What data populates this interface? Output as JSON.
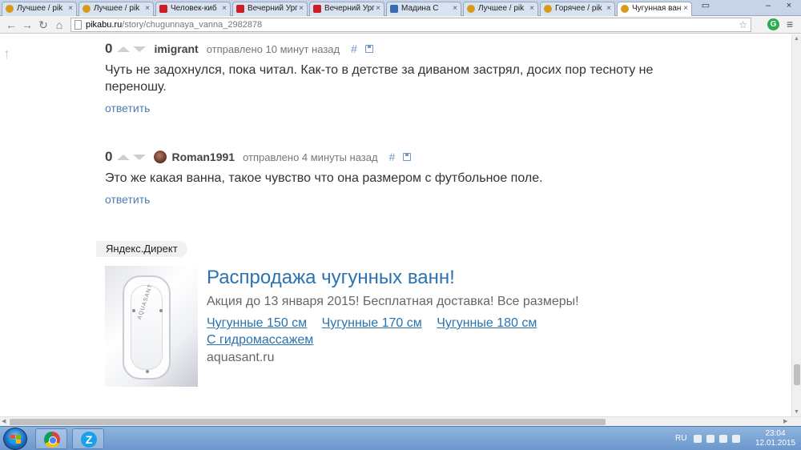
{
  "browser": {
    "tabs": [
      {
        "title": "Лучшее / pik",
        "favicon": "pikabu-icon"
      },
      {
        "title": "Лучшее / pik",
        "favicon": "pikabu-icon"
      },
      {
        "title": "Человек-киб",
        "favicon": "youtube-icon"
      },
      {
        "title": "Вечерний Ург",
        "favicon": "youtube-icon"
      },
      {
        "title": "Вечерний Ург",
        "favicon": "youtube-icon"
      },
      {
        "title": "Мадина С",
        "favicon": "video-icon"
      },
      {
        "title": "Лучшее / pik",
        "favicon": "pikabu-icon"
      },
      {
        "title": "Горячее / pik",
        "favicon": "pikabu-icon"
      },
      {
        "title": "Чугунная ван",
        "favicon": "pikabu-icon",
        "active": true
      }
    ],
    "url_host": "pikabu.ru",
    "url_path": "/story/chugunnaya_vanna_2982878"
  },
  "comments": [
    {
      "score": "0",
      "author": "imigrant",
      "meta": "отправлено 10 минут назад",
      "hash": "#",
      "text": "Чуть не задохнулся, пока читал. Как-то в детстве за диваном застрял, досих пор тесноту не переношу.",
      "reply": "ответить"
    },
    {
      "score": "0",
      "author": "Roman1991",
      "meta": "отправлено 4 минуты назад",
      "hash": "#",
      "text": "Это же какая ванна, такое чувство что она размером с футбольное поле.",
      "reply": "ответить"
    }
  ],
  "ad": {
    "label": "Яндекс.Директ",
    "title": "Распродажа чугунных ванн!",
    "description": "Акция до 13 января 2015! Бесплатная доставка! Все размеры!",
    "links": [
      "Чугунные 150 см",
      "Чугунные 170 см",
      "Чугунные 180 см",
      "С гидромассажем"
    ],
    "domain": "aquasant.ru",
    "image_brand": "AQUASANT"
  },
  "taskbar": {
    "language": "RU",
    "time": "23:04",
    "date": "12.01.2015"
  },
  "colors": {
    "link": "#4b7cb2",
    "ad_title": "#2a73b0"
  }
}
